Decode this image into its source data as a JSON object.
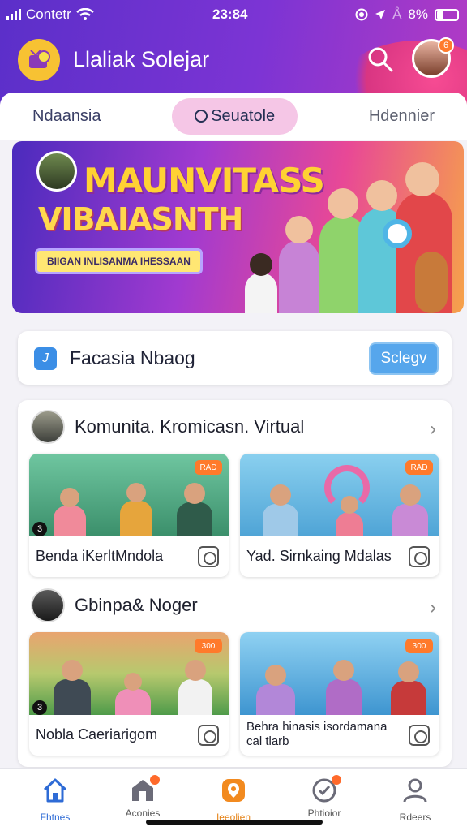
{
  "status_bar": {
    "carrier": "Contetr",
    "time": "23:84",
    "battery": "8%"
  },
  "header": {
    "app_title": "Llaliak Solejar",
    "notification_count": "6"
  },
  "tabs": [
    {
      "label": "Ndaansia"
    },
    {
      "label": "Seuatole"
    },
    {
      "label": "Hdennier"
    }
  ],
  "banner": {
    "title_line1": "MAUNVITASS",
    "title_line2": "VIBAIASNTH",
    "pill": "BIIGAN INLISANMA IHESSAAN"
  },
  "search": {
    "label": "Facasia Nbaog",
    "button": "Sclegv"
  },
  "community": {
    "sections": [
      {
        "title": "Komunita. Kromicasn. Virtual",
        "tiles": [
          {
            "caption": "Benda iKerltMndola",
            "badge": "RAD",
            "number": "3"
          },
          {
            "caption": "Yad. Sirnkaing Mdalas",
            "badge": "RAD"
          }
        ]
      },
      {
        "title": "Gbinpa& Noger",
        "tiles": [
          {
            "caption": "Nobla Caeriarigom",
            "badge": "300",
            "number": "3"
          },
          {
            "caption": "Behra hinasis isordamana cal tlarb",
            "badge": "300"
          }
        ]
      }
    ]
  },
  "bottom_nav": [
    {
      "label": "Fhtnes",
      "icon": "home-icon"
    },
    {
      "label": "Aconies",
      "icon": "shop-icon"
    },
    {
      "label": "Ieeolien",
      "icon": "location-icon"
    },
    {
      "label": "Phtioior",
      "icon": "check-badge-icon"
    },
    {
      "label": "Rdeers",
      "icon": "profile-icon"
    }
  ],
  "colors": {
    "header": "#6a31cf",
    "accent": "#ff7a2b",
    "button": "#56a6ec",
    "active_tab": "#f5c6e6"
  }
}
